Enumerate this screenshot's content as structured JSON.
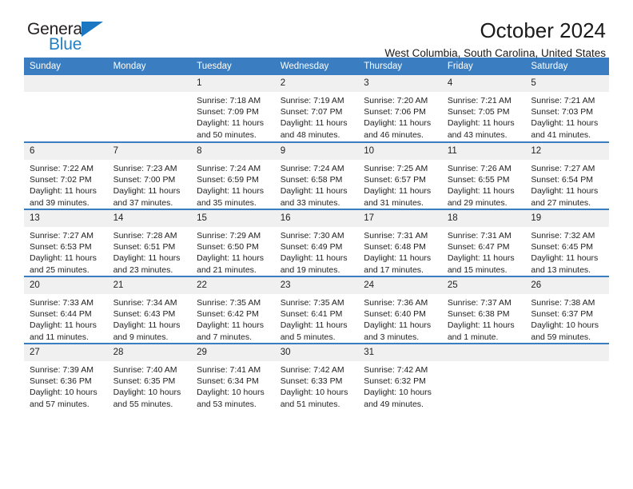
{
  "brand": {
    "name_top": "General",
    "name_bottom": "Blue",
    "accent_color": "#2380c5",
    "triangle_color": "#1c77c3"
  },
  "header": {
    "title": "October 2024",
    "subtitle": "West Columbia, South Carolina, United States"
  },
  "calendar": {
    "header_bg": "#3a7dc0",
    "header_text_color": "#ffffff",
    "daynum_bg": "#f0f0f0",
    "weekdays": [
      "Sunday",
      "Monday",
      "Tuesday",
      "Wednesday",
      "Thursday",
      "Friday",
      "Saturday"
    ],
    "labels": {
      "sunrise": "Sunrise:",
      "sunset": "Sunset:",
      "daylight": "Daylight:"
    },
    "weeks": [
      [
        {
          "day": "",
          "blank": true
        },
        {
          "day": "",
          "blank": true
        },
        {
          "day": "1",
          "sunrise": "Sunrise: 7:18 AM",
          "sunset": "Sunset: 7:09 PM",
          "daylight": "Daylight: 11 hours and 50 minutes."
        },
        {
          "day": "2",
          "sunrise": "Sunrise: 7:19 AM",
          "sunset": "Sunset: 7:07 PM",
          "daylight": "Daylight: 11 hours and 48 minutes."
        },
        {
          "day": "3",
          "sunrise": "Sunrise: 7:20 AM",
          "sunset": "Sunset: 7:06 PM",
          "daylight": "Daylight: 11 hours and 46 minutes."
        },
        {
          "day": "4",
          "sunrise": "Sunrise: 7:21 AM",
          "sunset": "Sunset: 7:05 PM",
          "daylight": "Daylight: 11 hours and 43 minutes."
        },
        {
          "day": "5",
          "sunrise": "Sunrise: 7:21 AM",
          "sunset": "Sunset: 7:03 PM",
          "daylight": "Daylight: 11 hours and 41 minutes."
        }
      ],
      [
        {
          "day": "6",
          "sunrise": "Sunrise: 7:22 AM",
          "sunset": "Sunset: 7:02 PM",
          "daylight": "Daylight: 11 hours and 39 minutes."
        },
        {
          "day": "7",
          "sunrise": "Sunrise: 7:23 AM",
          "sunset": "Sunset: 7:00 PM",
          "daylight": "Daylight: 11 hours and 37 minutes."
        },
        {
          "day": "8",
          "sunrise": "Sunrise: 7:24 AM",
          "sunset": "Sunset: 6:59 PM",
          "daylight": "Daylight: 11 hours and 35 minutes."
        },
        {
          "day": "9",
          "sunrise": "Sunrise: 7:24 AM",
          "sunset": "Sunset: 6:58 PM",
          "daylight": "Daylight: 11 hours and 33 minutes."
        },
        {
          "day": "10",
          "sunrise": "Sunrise: 7:25 AM",
          "sunset": "Sunset: 6:57 PM",
          "daylight": "Daylight: 11 hours and 31 minutes."
        },
        {
          "day": "11",
          "sunrise": "Sunrise: 7:26 AM",
          "sunset": "Sunset: 6:55 PM",
          "daylight": "Daylight: 11 hours and 29 minutes."
        },
        {
          "day": "12",
          "sunrise": "Sunrise: 7:27 AM",
          "sunset": "Sunset: 6:54 PM",
          "daylight": "Daylight: 11 hours and 27 minutes."
        }
      ],
      [
        {
          "day": "13",
          "sunrise": "Sunrise: 7:27 AM",
          "sunset": "Sunset: 6:53 PM",
          "daylight": "Daylight: 11 hours and 25 minutes."
        },
        {
          "day": "14",
          "sunrise": "Sunrise: 7:28 AM",
          "sunset": "Sunset: 6:51 PM",
          "daylight": "Daylight: 11 hours and 23 minutes."
        },
        {
          "day": "15",
          "sunrise": "Sunrise: 7:29 AM",
          "sunset": "Sunset: 6:50 PM",
          "daylight": "Daylight: 11 hours and 21 minutes."
        },
        {
          "day": "16",
          "sunrise": "Sunrise: 7:30 AM",
          "sunset": "Sunset: 6:49 PM",
          "daylight": "Daylight: 11 hours and 19 minutes."
        },
        {
          "day": "17",
          "sunrise": "Sunrise: 7:31 AM",
          "sunset": "Sunset: 6:48 PM",
          "daylight": "Daylight: 11 hours and 17 minutes."
        },
        {
          "day": "18",
          "sunrise": "Sunrise: 7:31 AM",
          "sunset": "Sunset: 6:47 PM",
          "daylight": "Daylight: 11 hours and 15 minutes."
        },
        {
          "day": "19",
          "sunrise": "Sunrise: 7:32 AM",
          "sunset": "Sunset: 6:45 PM",
          "daylight": "Daylight: 11 hours and 13 minutes."
        }
      ],
      [
        {
          "day": "20",
          "sunrise": "Sunrise: 7:33 AM",
          "sunset": "Sunset: 6:44 PM",
          "daylight": "Daylight: 11 hours and 11 minutes."
        },
        {
          "day": "21",
          "sunrise": "Sunrise: 7:34 AM",
          "sunset": "Sunset: 6:43 PM",
          "daylight": "Daylight: 11 hours and 9 minutes."
        },
        {
          "day": "22",
          "sunrise": "Sunrise: 7:35 AM",
          "sunset": "Sunset: 6:42 PM",
          "daylight": "Daylight: 11 hours and 7 minutes."
        },
        {
          "day": "23",
          "sunrise": "Sunrise: 7:35 AM",
          "sunset": "Sunset: 6:41 PM",
          "daylight": "Daylight: 11 hours and 5 minutes."
        },
        {
          "day": "24",
          "sunrise": "Sunrise: 7:36 AM",
          "sunset": "Sunset: 6:40 PM",
          "daylight": "Daylight: 11 hours and 3 minutes."
        },
        {
          "day": "25",
          "sunrise": "Sunrise: 7:37 AM",
          "sunset": "Sunset: 6:38 PM",
          "daylight": "Daylight: 11 hours and 1 minute."
        },
        {
          "day": "26",
          "sunrise": "Sunrise: 7:38 AM",
          "sunset": "Sunset: 6:37 PM",
          "daylight": "Daylight: 10 hours and 59 minutes."
        }
      ],
      [
        {
          "day": "27",
          "sunrise": "Sunrise: 7:39 AM",
          "sunset": "Sunset: 6:36 PM",
          "daylight": "Daylight: 10 hours and 57 minutes."
        },
        {
          "day": "28",
          "sunrise": "Sunrise: 7:40 AM",
          "sunset": "Sunset: 6:35 PM",
          "daylight": "Daylight: 10 hours and 55 minutes."
        },
        {
          "day": "29",
          "sunrise": "Sunrise: 7:41 AM",
          "sunset": "Sunset: 6:34 PM",
          "daylight": "Daylight: 10 hours and 53 minutes."
        },
        {
          "day": "30",
          "sunrise": "Sunrise: 7:42 AM",
          "sunset": "Sunset: 6:33 PM",
          "daylight": "Daylight: 10 hours and 51 minutes."
        },
        {
          "day": "31",
          "sunrise": "Sunrise: 7:42 AM",
          "sunset": "Sunset: 6:32 PM",
          "daylight": "Daylight: 10 hours and 49 minutes."
        },
        {
          "day": "",
          "blank": true
        },
        {
          "day": "",
          "blank": true
        }
      ]
    ]
  }
}
